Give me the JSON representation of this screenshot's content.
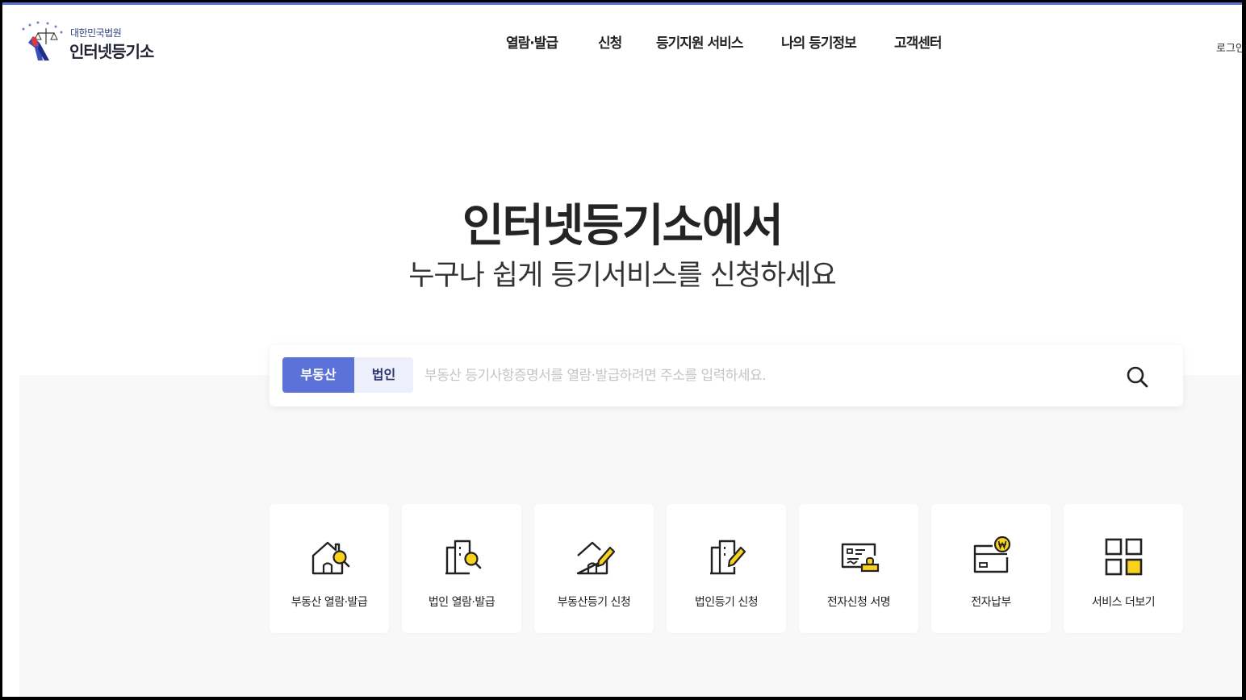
{
  "header": {
    "logo_subtitle": "대한민국법원",
    "logo_title": "인터넷등기소",
    "nav": [
      "열람·발급",
      "신청",
      "등기지원 서비스",
      "나의 등기정보",
      "고객센터"
    ],
    "login_label": "로그인"
  },
  "hero": {
    "title": "인터넷등기소에서",
    "subtitle": "누구나 쉽게 등기서비스를 신청하세요"
  },
  "search": {
    "tabs": [
      {
        "label": "부동산",
        "active": true
      },
      {
        "label": "법인",
        "active": false
      }
    ],
    "placeholder": "부동산 등기사항증명서를 열람·발급하려면 주소를 입력하세요.",
    "value": ""
  },
  "services": [
    {
      "label": "부동산 열람·발급",
      "icon": "house-search-icon"
    },
    {
      "label": "법인 열람·발급",
      "icon": "building-search-icon"
    },
    {
      "label": "부동산등기 신청",
      "icon": "house-pencil-icon"
    },
    {
      "label": "법인등기 신청",
      "icon": "building-pencil-icon"
    },
    {
      "label": "전자신청 서명",
      "icon": "signature-stamp-icon"
    },
    {
      "label": "전자납부",
      "icon": "card-won-icon"
    },
    {
      "label": "서비스 더보기",
      "icon": "grid-more-icon"
    }
  ],
  "colors": {
    "accent": "#5b73d8",
    "icon_yellow": "#f8d21c",
    "band": "#f8f8f9"
  }
}
